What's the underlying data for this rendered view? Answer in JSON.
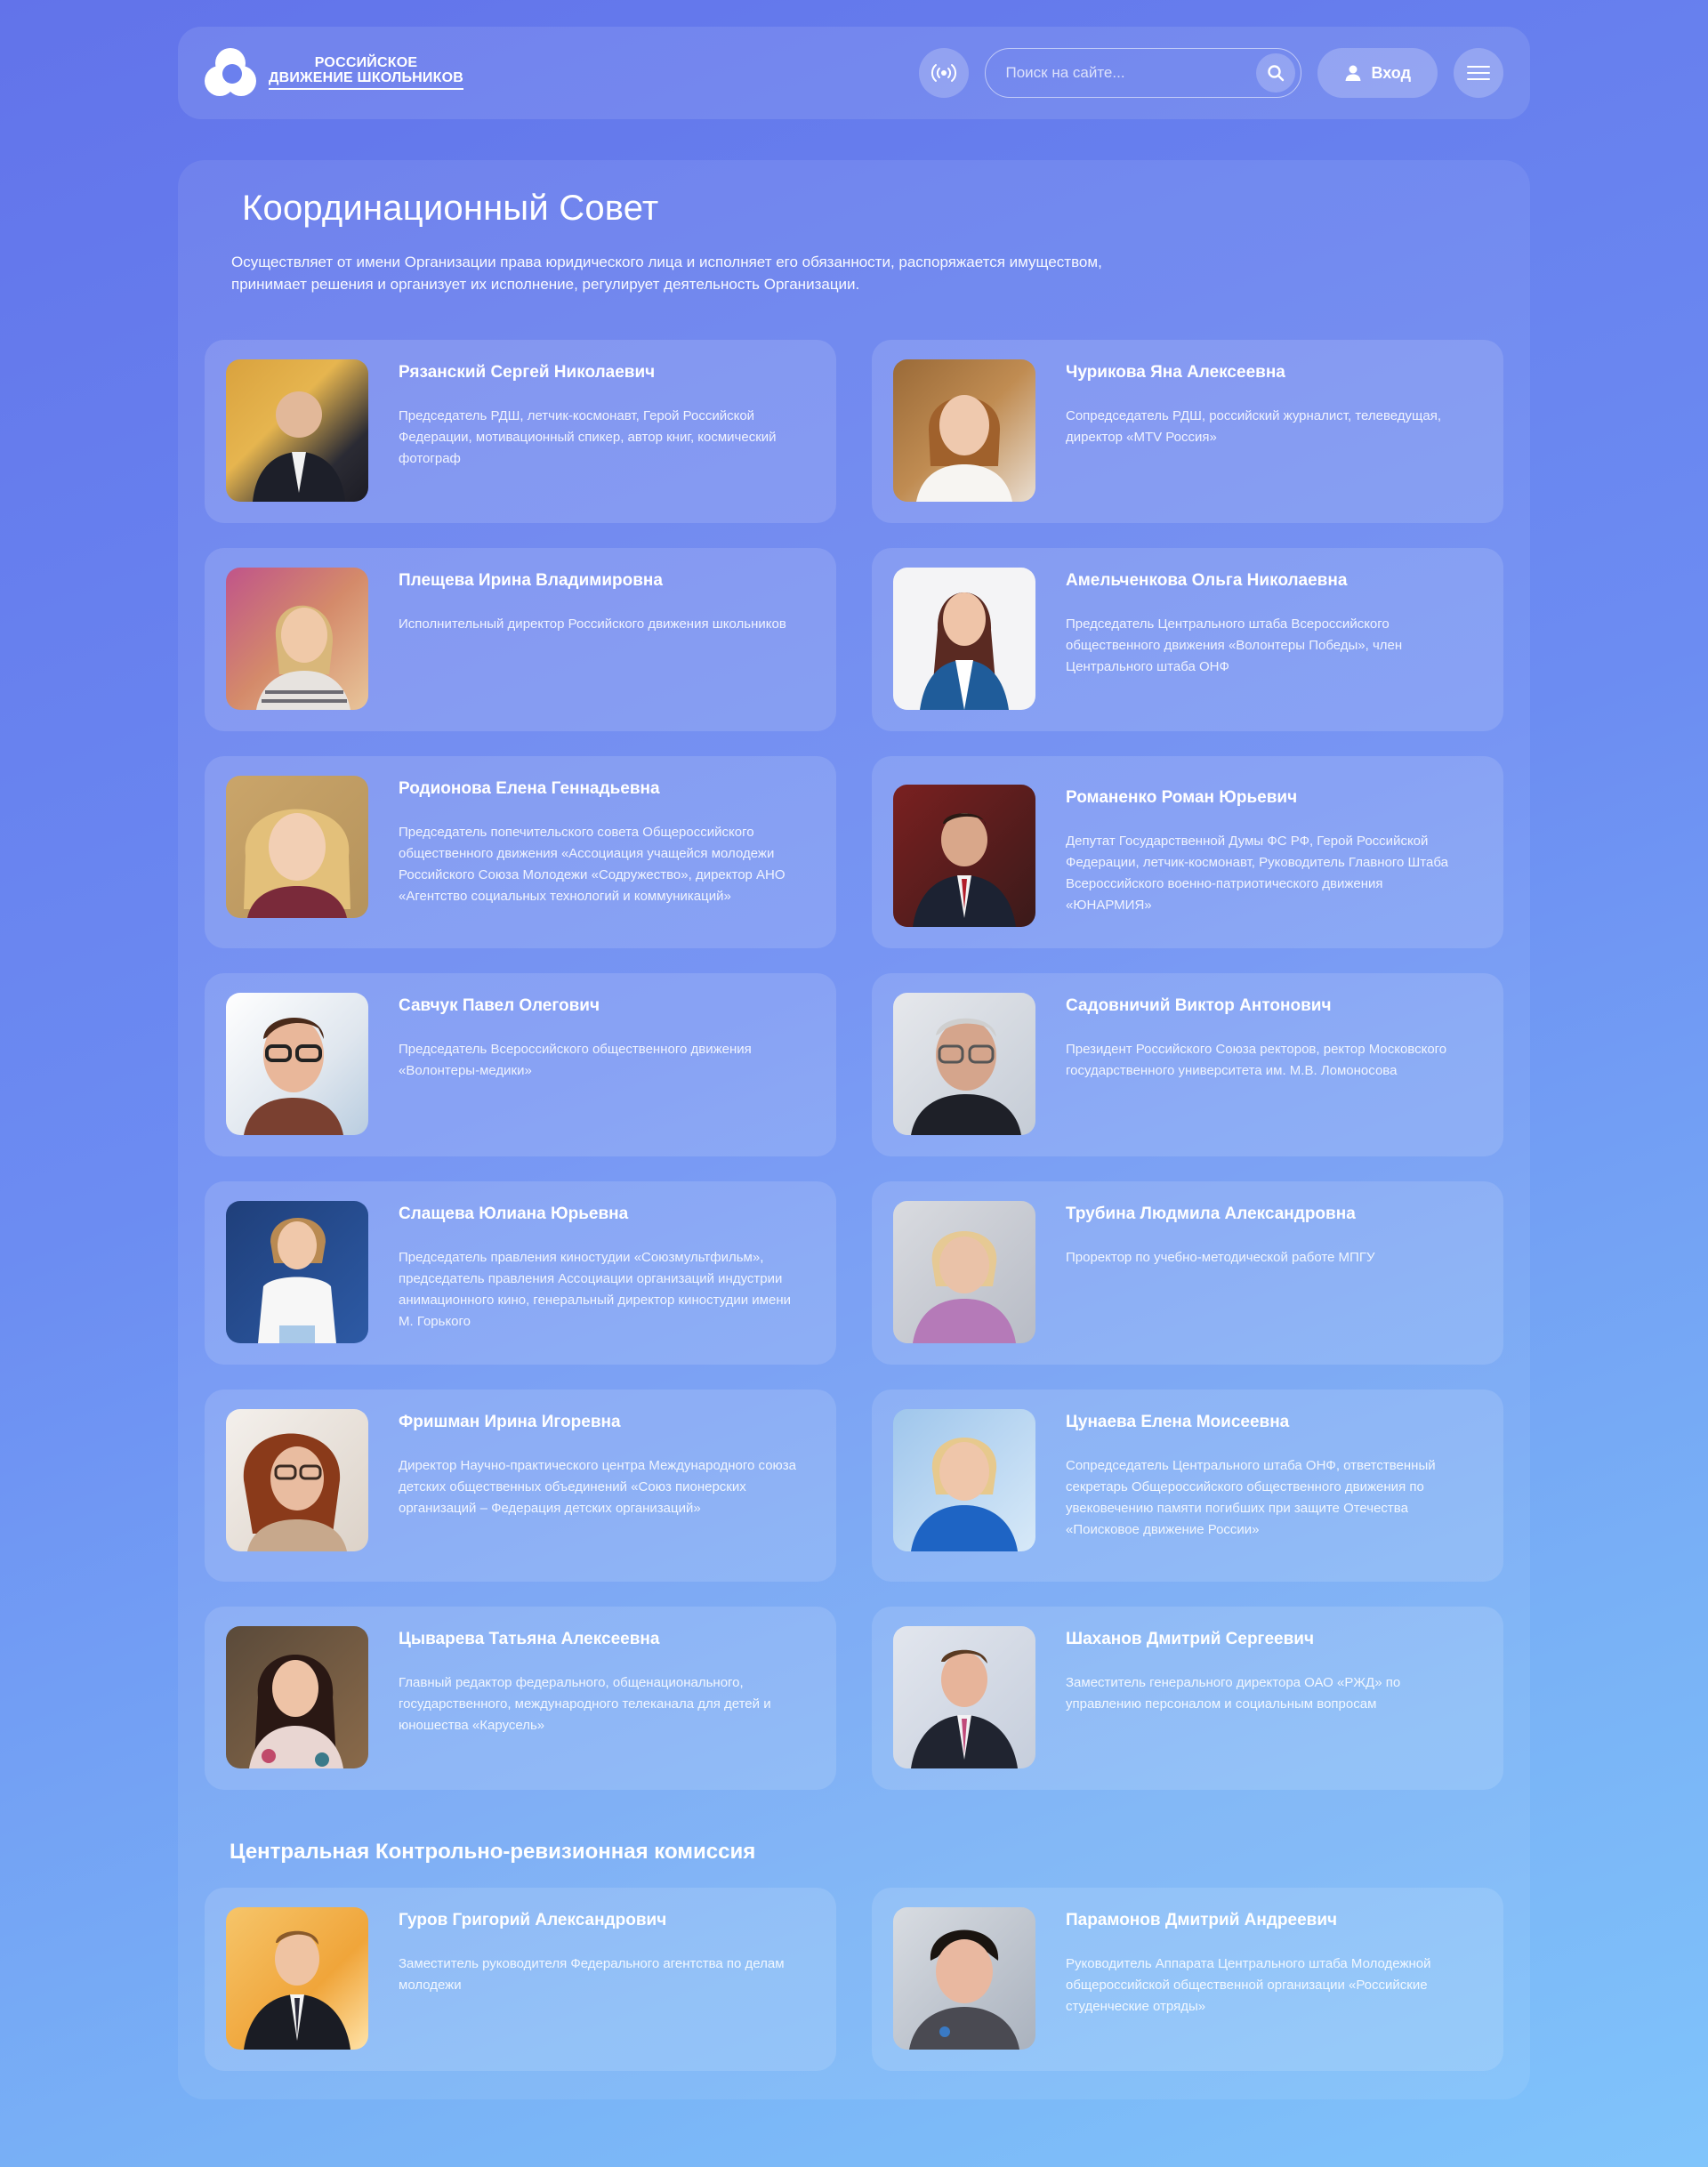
{
  "header": {
    "logo_line1": "РОССИЙСКОЕ",
    "logo_line2": "ДВИЖЕНИЕ ШКОЛЬНИКОВ",
    "search_placeholder": "Поиск на сайте...",
    "login_label": "Вход",
    "icons": [
      "broadcast-icon",
      "search-icon",
      "user-icon",
      "menu-icon"
    ]
  },
  "main": {
    "title": "Координационный Совет",
    "description": "Осуществляет от имени Организации права юридического лица и исполняет его обязанности, распоряжается имуществом, принимает решения и организует их исполнение, регулирует деятельность Организации.",
    "members": [
      {
        "name": "Рязанский Сергей Николаевич",
        "role": "Председатель РДШ, летчик-космонавт, Герой Российской Федерации, мотивационный спикер, автор книг, космический фотограф"
      },
      {
        "name": "Чурикова Яна Алексеевна",
        "role": "Сопредседатель РДШ, российский журналист, телеведущая, директор «MTV Россия»"
      },
      {
        "name": "Плещева Ирина Владимировна",
        "role": "Исполнительный директор Российского движения школьников"
      },
      {
        "name": "Амельченкова Ольга Николаевна",
        "role": "Председатель Центрального штаба Всероссийского общественного движения «Волонтеры Победы», член Центрального штаба ОНФ"
      },
      {
        "name": "Родионова Елена Геннадьевна",
        "role": "Председатель попечительского совета Общероссийского общественного движения «Ассоциация учащейся молодежи Российского Союза Молодежи «Содружество», директор АНО «Агентство социальных технологий и коммуникаций»"
      },
      {
        "name": "Романенко Роман Юрьевич",
        "role": "Депутат Государственной Думы ФС РФ, Герой Российской Федерации, летчик-космонавт, Руководитель Главного Штаба Всероссийского военно-патриотического движения «ЮНАРМИЯ»"
      },
      {
        "name": "Савчук Павел Олегович",
        "role": "Председатель Всероссийского общественного движения «Волонтеры-медики»"
      },
      {
        "name": "Садовничий Виктор Антонович",
        "role": "Президент Российского Союза ректоров, ректор Московского государственного университета им. М.В. Ломоносова"
      },
      {
        "name": "Слащева Юлиана Юрьевна",
        "role": "Председатель правления киностудии «Союзмультфильм», председатель правления Ассоциации организаций индустрии анимационного кино, генеральный директор киностудии имени М. Горького"
      },
      {
        "name": "Трубина Людмила Александровна",
        "role": "Проректор по учебно-методической работе МПГУ"
      },
      {
        "name": "Фришман Ирина Игоревна",
        "role": "Директор Научно-практического центра Международного союза детских общественных объединений «Союз пионерских организаций – Федерация детских организаций»"
      },
      {
        "name": "Цунаева Елена Моисеевна",
        "role": "Сопредседатель Центрального штаба ОНФ, ответственный секретарь Общероссийского общественного движения по увековечению памяти погибших при защите Отечества «Поисковое движение России»"
      },
      {
        "name": "Цыварева Татьяна Алексеевна",
        "role": "Главный редактор федерального, общенационального, государственного, международного телеканала для детей и юношества «Карусель»"
      },
      {
        "name": "Шаханов Дмитрий Сергеевич",
        "role": "Заместитель генерального директора ОАО «РЖД» по управлению персоналом и социальным вопросам"
      }
    ]
  },
  "commission": {
    "title": "Центральная Контрольно-ревизионная комиссия",
    "members": [
      {
        "name": "Гуров Григорий Александрович",
        "role": "Заместитель руководителя Федерального агентства по делам молодежи"
      },
      {
        "name": "Парамонов Дмитрий Андреевич",
        "role": "Руководитель Аппарата Центрального штаба Молодежной общероссийской общественной организации «Российские студенческие отряды»"
      }
    ]
  }
}
